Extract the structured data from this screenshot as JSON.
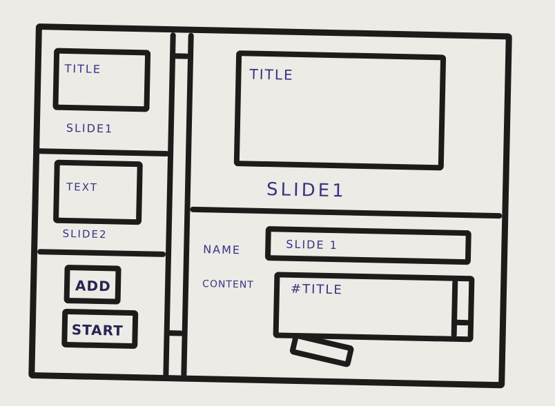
{
  "slides_panel": {
    "items": [
      {
        "thumb_text": "TITLE",
        "label": "SLIDE1"
      },
      {
        "thumb_text": "TEXT",
        "label": "SLIDE2"
      }
    ],
    "add_label": "ADD",
    "start_label": "START"
  },
  "preview": {
    "title": "TITLE",
    "caption": "SLIDE1"
  },
  "editor": {
    "name_label": "NAME",
    "name_value": "SLIDE 1",
    "content_label": "CONTENT",
    "content_value": "#TITLE"
  }
}
